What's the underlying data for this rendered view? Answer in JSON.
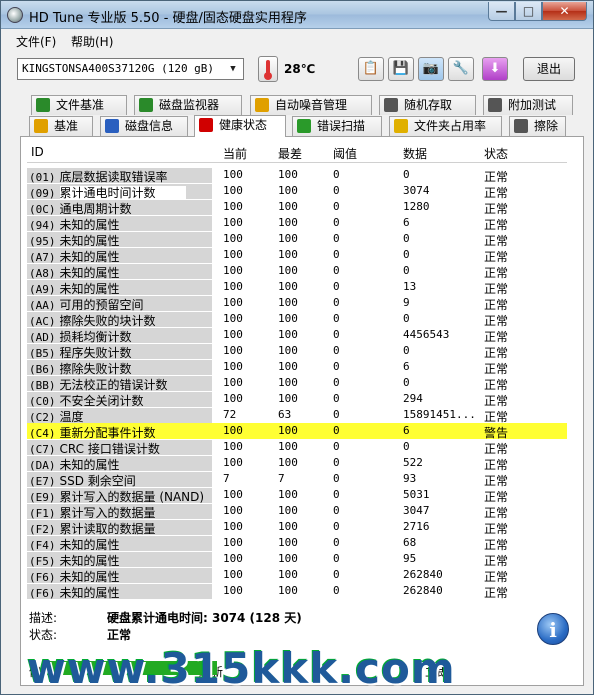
{
  "window": {
    "title": "HD Tune 专业版 5.50 - 硬盘/固态硬盘实用程序",
    "min_label": "—",
    "max_label": "□",
    "close_label": "✕"
  },
  "menu": {
    "file": "文件(F)",
    "help": "帮助(H)"
  },
  "toolbar": {
    "drive": "KINGSTONSA400S37120G (120 gB)",
    "temperature": "28℃",
    "exit_label": "退出",
    "icons": [
      "copy-icon",
      "save-icon",
      "camera-icon",
      "options-icon",
      "download-icon"
    ]
  },
  "tabs_top": [
    {
      "label": "文件基准",
      "icon": "file-benchmark-icon",
      "color": "#2a8a2a"
    },
    {
      "label": "磁盘监视器",
      "icon": "disk-monitor-icon",
      "color": "#2a8a2a"
    },
    {
      "label": "自动噪音管理",
      "icon": "aam-icon",
      "color": "#e0a000"
    },
    {
      "label": "随机存取",
      "icon": "random-access-icon",
      "color": "#444"
    },
    {
      "label": "附加测试",
      "icon": "extra-tests-icon",
      "color": "#444"
    }
  ],
  "tabs_bottom": [
    {
      "label": "基准",
      "icon": "benchmark-icon",
      "color": "#e0a000"
    },
    {
      "label": "磁盘信息",
      "icon": "info-icon",
      "color": "#2a5fbf"
    },
    {
      "label": "健康状态",
      "icon": "health-icon",
      "color": "#d00000",
      "active": true
    },
    {
      "label": "错误扫描",
      "icon": "error-scan-icon",
      "color": "#2a9a2a"
    },
    {
      "label": "文件夹占用率",
      "icon": "folder-icon",
      "color": "#e0b000"
    },
    {
      "label": "擦除",
      "icon": "erase-icon",
      "color": "#444"
    }
  ],
  "table": {
    "headers": {
      "id": "ID",
      "current": "当前",
      "worst": "最差",
      "threshold": "阈值",
      "data": "数据",
      "status": "状态"
    },
    "rows": [
      {
        "id": "(01)",
        "name": "底层数据读取错误率",
        "current": "100",
        "worst": "100",
        "threshold": "0",
        "data": "0",
        "status": "正常"
      },
      {
        "id": "(09)",
        "name": "累计通电时间计数",
        "current": "100",
        "worst": "100",
        "threshold": "0",
        "data": "3074",
        "status": "正常",
        "selected": true
      },
      {
        "id": "(0C)",
        "name": "通电周期计数",
        "current": "100",
        "worst": "100",
        "threshold": "0",
        "data": "1280",
        "status": "正常"
      },
      {
        "id": "(94)",
        "name": "未知的属性",
        "current": "100",
        "worst": "100",
        "threshold": "0",
        "data": "6",
        "status": "正常"
      },
      {
        "id": "(95)",
        "name": "未知的属性",
        "current": "100",
        "worst": "100",
        "threshold": "0",
        "data": "0",
        "status": "正常"
      },
      {
        "id": "(A7)",
        "name": "未知的属性",
        "current": "100",
        "worst": "100",
        "threshold": "0",
        "data": "0",
        "status": "正常"
      },
      {
        "id": "(A8)",
        "name": "未知的属性",
        "current": "100",
        "worst": "100",
        "threshold": "0",
        "data": "0",
        "status": "正常"
      },
      {
        "id": "(A9)",
        "name": "未知的属性",
        "current": "100",
        "worst": "100",
        "threshold": "0",
        "data": "13",
        "status": "正常"
      },
      {
        "id": "(AA)",
        "name": "可用的预留空间",
        "current": "100",
        "worst": "100",
        "threshold": "0",
        "data": "9",
        "status": "正常"
      },
      {
        "id": "(AC)",
        "name": "擦除失败的块计数",
        "current": "100",
        "worst": "100",
        "threshold": "0",
        "data": "0",
        "status": "正常"
      },
      {
        "id": "(AD)",
        "name": "损耗均衡计数",
        "current": "100",
        "worst": "100",
        "threshold": "0",
        "data": "4456543",
        "status": "正常"
      },
      {
        "id": "(B5)",
        "name": "程序失败计数",
        "current": "100",
        "worst": "100",
        "threshold": "0",
        "data": "0",
        "status": "正常"
      },
      {
        "id": "(B6)",
        "name": "擦除失败计数",
        "current": "100",
        "worst": "100",
        "threshold": "0",
        "data": "6",
        "status": "正常"
      },
      {
        "id": "(BB)",
        "name": "无法校正的错误计数",
        "current": "100",
        "worst": "100",
        "threshold": "0",
        "data": "0",
        "status": "正常"
      },
      {
        "id": "(C0)",
        "name": "不安全关闭计数",
        "current": "100",
        "worst": "100",
        "threshold": "0",
        "data": "294",
        "status": "正常"
      },
      {
        "id": "(C2)",
        "name": "温度",
        "current": "72",
        "worst": "63",
        "threshold": "0",
        "data": "15891451...",
        "status": "正常"
      },
      {
        "id": "(C4)",
        "name": "重新分配事件计数",
        "current": "100",
        "worst": "100",
        "threshold": "0",
        "data": "6",
        "status": "警告",
        "warn": true
      },
      {
        "id": "(C7)",
        "name": "CRC 接口错误计数",
        "current": "100",
        "worst": "100",
        "threshold": "0",
        "data": "0",
        "status": "正常"
      },
      {
        "id": "(DA)",
        "name": "未知的属性",
        "current": "100",
        "worst": "100",
        "threshold": "0",
        "data": "522",
        "status": "正常"
      },
      {
        "id": "(E7)",
        "name": "SSD 剩余空间",
        "current": "7",
        "worst": "7",
        "threshold": "0",
        "data": "93",
        "status": "正常"
      },
      {
        "id": "(E9)",
        "name": "累计写入的数据量 (NAND)",
        "current": "100",
        "worst": "100",
        "threshold": "0",
        "data": "5031",
        "status": "正常"
      },
      {
        "id": "(F1)",
        "name": "累计写入的数据量",
        "current": "100",
        "worst": "100",
        "threshold": "0",
        "data": "3047",
        "status": "正常"
      },
      {
        "id": "(F2)",
        "name": "累计读取的数据量",
        "current": "100",
        "worst": "100",
        "threshold": "0",
        "data": "2716",
        "status": "正常"
      },
      {
        "id": "(F4)",
        "name": "未知的属性",
        "current": "100",
        "worst": "100",
        "threshold": "0",
        "data": "68",
        "status": "正常"
      },
      {
        "id": "(F5)",
        "name": "未知的属性",
        "current": "100",
        "worst": "100",
        "threshold": "0",
        "data": "95",
        "status": "正常"
      },
      {
        "id": "(F6)",
        "name": "未知的属性",
        "current": "100",
        "worst": "100",
        "threshold": "0",
        "data": "262840",
        "status": "正常"
      },
      {
        "id": "(F6)",
        "name": "未知的属性",
        "current": "100",
        "worst": "100",
        "threshold": "0",
        "data": "262840",
        "status": "正常"
      }
    ]
  },
  "details": {
    "desc_label": "描述:",
    "desc_value": "硬盘累计通电时间: 3074 (128 天)",
    "status_label": "状态:",
    "status_value": "正常",
    "info_label": "i"
  },
  "statusbar": {
    "left": "健",
    "mid": "刷新",
    "right": "立即"
  },
  "watermark": "www.315kkk.com"
}
